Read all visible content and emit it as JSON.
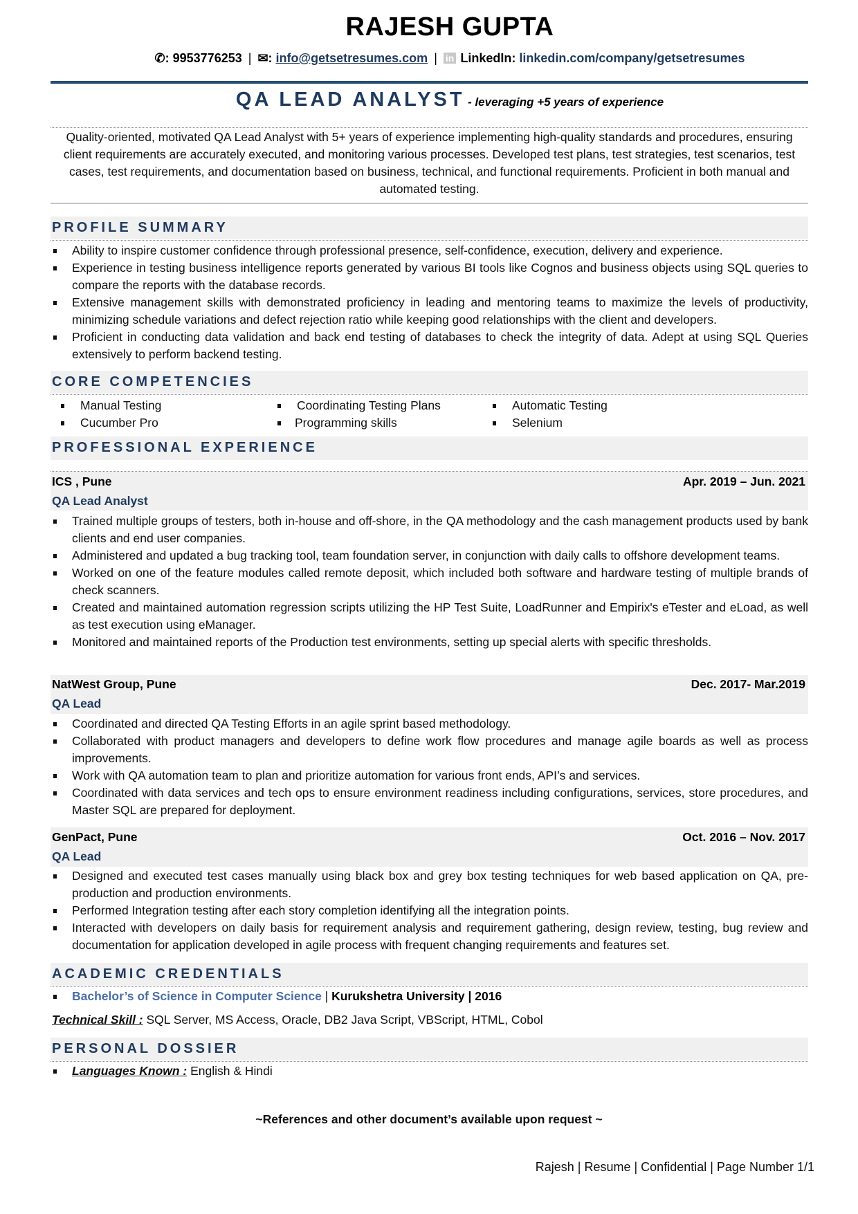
{
  "header": {
    "name": "RAJESH GUPTA",
    "phone_icon": "phone-icon",
    "phone_prefix": "✆:",
    "phone": "9953776253",
    "separator": "|",
    "email_icon": "envelope-icon",
    "email_glyph": "✉:",
    "email": "info@getsetresumes.com",
    "linkedin_icon": "linkedin-icon",
    "linkedin_badge": "in",
    "linkedin_label": "LinkedIn:",
    "linkedin_url": "linkedin.com/company/getsetresumes"
  },
  "title": {
    "role": "QA LEAD ANALYST",
    "tagline": "- leveraging +5  years of experience"
  },
  "summary": "Quality-oriented, motivated QA Lead Analyst with 5+ years of experience implementing high-quality standards and procedures, ensuring client requirements are accurately executed, and monitoring various processes. Developed test plans, test strategies, test scenarios, test cases, test requirements, and documentation based on business, technical, and functional requirements. Proficient in both manual and automated testing.",
  "sections": {
    "profile": "PROFILE SUMMARY",
    "core": "CORE COMPETENCIES",
    "experience": "PROFESSIONAL EXPERIENCE",
    "academic": "ACADEMIC CREDENTIALS",
    "personal": "PERSONAL DOSSIER"
  },
  "profile_bullets": [
    "Ability to inspire customer confidence through professional presence, self-confidence, execution, delivery and experience.",
    "Experience in testing business intelligence reports generated by various BI tools like Cognos and business objects using SQL queries to compare the reports with the database records.",
    "Extensive management skills with demonstrated proficiency in leading and mentoring teams to maximize the levels of productivity, minimizing schedule variations and defect rejection ratio while keeping good relationships with the client and developers.",
    "Proficient  in conducting data validation and back end testing of databases to check the integrity of data. Adept at using SQL Queries extensively to perform backend testing."
  ],
  "competencies": [
    "Manual Testing",
    " Coordinating Testing Plans",
    "Automatic Testing",
    "Cucumber Pro",
    "Programming skills",
    "Selenium"
  ],
  "jobs": [
    {
      "company": "ICS , Pune",
      "dates": "Apr. 2019 – Jun. 2021",
      "role": "QA Lead Analyst",
      "bullets": [
        "Trained multiple groups of testers, both in-house and off-shore, in the QA methodology and the cash management products used by bank clients and end user companies.",
        "Administered and updated a bug tracking tool, team foundation server, in conjunction with daily calls to offshore development teams.",
        "Worked on one of the feature modules called remote deposit, which included both software and hardware testing of multiple brands of check scanners.",
        "Created and maintained automation regression scripts utilizing the HP Test Suite, LoadRunner and Empirix's eTester and eLoad, as well as test execution using eManager.",
        "Monitored and maintained reports of the Production test environments, setting up special alerts with specific thresholds."
      ]
    },
    {
      "company": "NatWest Group, Pune",
      "dates": "Dec. 2017- Mar.2019",
      "role": "QA Lead",
      "bullets": [
        "Coordinated and directed QA Testing Efforts in an agile sprint based methodology.",
        "Collaborated with product managers and developers to define work flow procedures and manage agile boards as well as process improvements.",
        "Work with QA automation team to plan and prioritize automation for various front ends, API’s and services.",
        "Coordinated with data services and tech ops to ensure environment readiness including configurations, services, store procedures, and Master SQL are prepared for deployment."
      ]
    },
    {
      "company": "GenPact, Pune",
      "dates": "Oct. 2016 – Nov. 2017",
      "role": "QA Lead",
      "bullets": [
        "Designed and executed test cases manually using black box and grey box testing techniques for web based application on QA, pre-production and production environments.",
        "Performed Integration testing after each story completion identifying all the integration points.",
        "Interacted with developers on daily basis for requirement analysis and requirement gathering, design review, testing, bug review and documentation for application developed in agile process with frequent changing requirements and features set."
      ]
    }
  ],
  "education": {
    "degree": "Bachelor’s of Science in Computer Science",
    "sep": " | ",
    "rest": "Kurukshetra University | 2016"
  },
  "technical": {
    "label": "Technical Skill :",
    "value": " SQL Server, MS Access, Oracle, DB2  Java Script, VBScript, HTML, Cobol"
  },
  "personal": {
    "label": "Languages Known :",
    "value": " English & Hindi"
  },
  "references": "~References and other document’s available upon request ~",
  "footer": "Rajesh | Resume | Confidential | Page Number 1/1",
  "colors": {
    "accent": "#1f3a5f",
    "rule": "#244e73",
    "band": "#f0f0f0",
    "degree": "#4a6fa5"
  }
}
